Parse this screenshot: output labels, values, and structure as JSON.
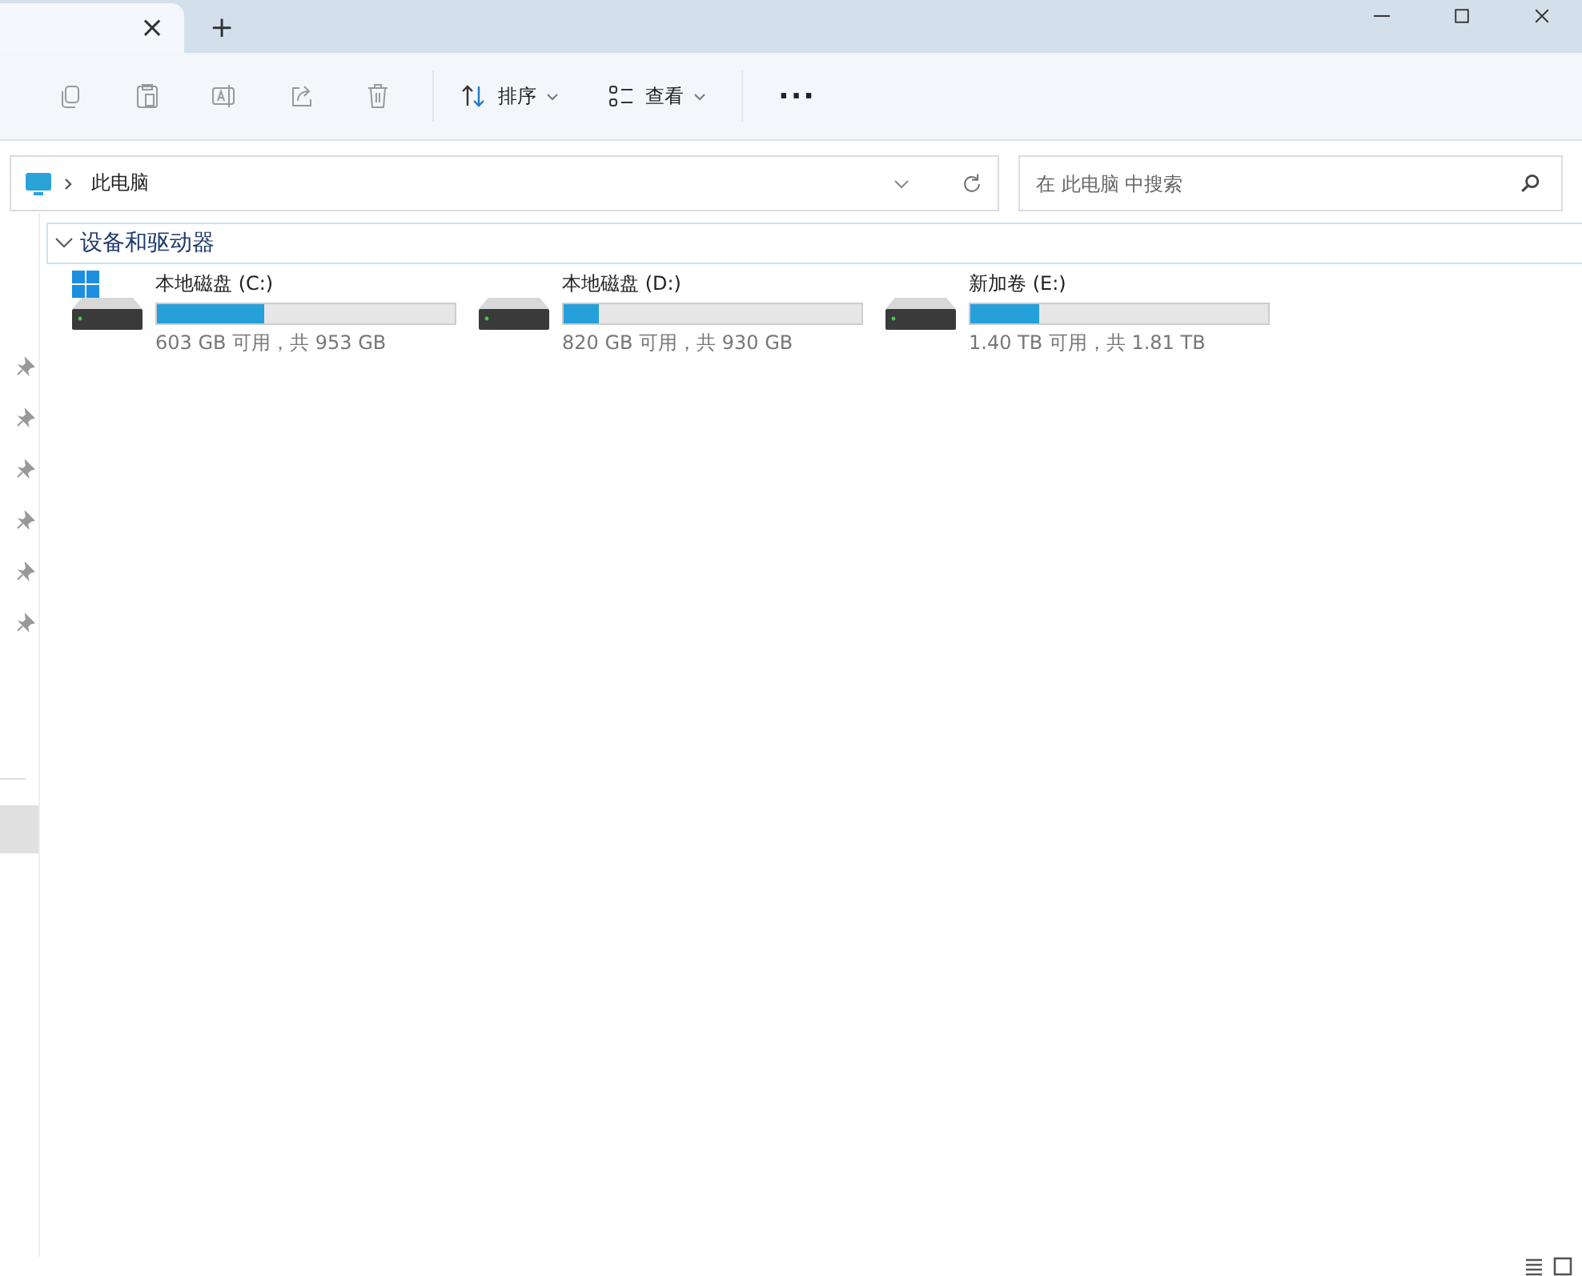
{
  "tab_bar": {
    "new_tab": "+",
    "close": "×"
  },
  "toolbar": {
    "sort": "排序",
    "view": "查看",
    "more": "···"
  },
  "address_bar": {
    "path": "此电脑"
  },
  "search": {
    "placeholder": "在 此电脑 中搜索"
  },
  "sidebar": {
    "pinned_items": [
      {
        "pinned": true
      },
      {
        "pinned": true
      },
      {
        "pinned": true
      },
      {
        "pinned": true
      },
      {
        "pinned": true
      },
      {
        "pinned": true
      }
    ],
    "lower_items": [
      {
        "selected": true
      }
    ]
  },
  "section": {
    "title": "设备和驱动器",
    "expanded": true
  },
  "drives": [
    {
      "name": "本地磁盘 (C:)",
      "kind": "system",
      "level": 0.36,
      "info": "603 GB 可用，共 953 GB"
    },
    {
      "name": "本地磁盘 (D:)",
      "kind": "disk",
      "level": 0.12,
      "info": "820 GB 可用，共 930 GB"
    },
    {
      "name": "新加卷 (E:)",
      "kind": "disk",
      "level": 0.23,
      "info": "1.40 TB 可用，共 1.81 TB"
    }
  ]
}
